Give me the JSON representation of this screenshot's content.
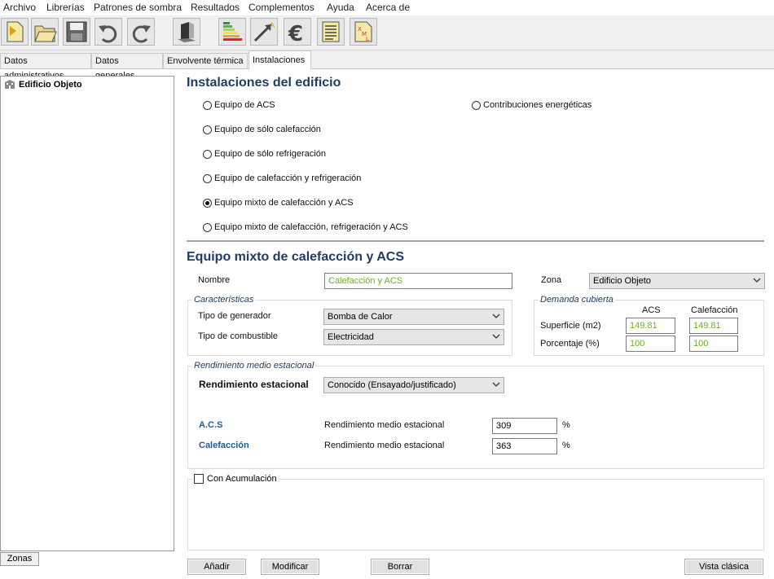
{
  "menu": [
    "Archivo",
    "Librerías",
    "Patrones de sombra",
    "Resultados",
    "Complementos",
    "Ayuda",
    "Acerca de"
  ],
  "toolbar": {
    "icons": [
      "new-file-icon",
      "open-folder-icon",
      "save-icon",
      "undo-icon",
      "redo-icon",
      "3d-view-icon",
      "energy-rating-icon",
      "improvement-measures-icon",
      "euro-icon",
      "report-icon",
      "xml-icon"
    ]
  },
  "tabs": [
    "Datos administrativos",
    "Datos generales",
    "Envolvente térmica",
    "Instalaciones"
  ],
  "active_tab": "Instalaciones",
  "tree": {
    "root": "Edificio Objeto"
  },
  "zonas_button": "Zonas",
  "installations": {
    "title": "Instalaciones del edificio",
    "options": [
      "Equipo de ACS",
      "Equipo de sólo calefacción",
      "Equipo de sólo refrigeración",
      "Equipo de calefacción y refrigeración",
      "Equipo mixto de calefacción y ACS",
      "Equipo mixto de calefacción, refrigeración y ACS"
    ],
    "selected": "Equipo mixto de calefacción y ACS",
    "contributions": "Contribuciones energéticas"
  },
  "equipment": {
    "title": "Equipo mixto de calefacción y ACS",
    "nombre_label": "Nombre",
    "nombre_value": "Calefacción y ACS",
    "zona_label": "Zona",
    "zona_value": "Edificio Objeto",
    "caracteristicas": {
      "legend": "Características",
      "tipo_generador_label": "Tipo de generador",
      "tipo_generador_value": "Bomba de Calor",
      "tipo_combustible_label": "Tipo de combustible",
      "tipo_combustible_value": "Electricidad"
    },
    "demanda": {
      "legend": "Demanda cubierta",
      "col_acs": "ACS",
      "col_calefaccion": "Calefacción",
      "superficie_label": "Superficie (m2)",
      "superficie_acs": "149.81",
      "superficie_calefaccion": "149.81",
      "porcentaje_label": "Porcentaje (%)",
      "porcentaje_acs": "100",
      "porcentaje_calefaccion": "100"
    },
    "rendimiento": {
      "legend": "Rendimiento medio estacional",
      "estacional_label": "Rendimiento estacional",
      "estacional_value": "Conocido (Ensayado/justificado)",
      "acs_label": "A.C.S",
      "acs_desc": "Rendimiento medio estacional",
      "acs_value": "309",
      "cal_label": "Calefacción",
      "cal_desc": "Rendimiento medio estacional",
      "cal_value": "363",
      "unit": "%"
    },
    "acumulacion_label": "Con Acumulación",
    "acumulacion_checked": false
  },
  "buttons": {
    "add": "Añadir",
    "modify": "Modificar",
    "delete": "Borrar",
    "classic_view": "Vista clásica"
  }
}
